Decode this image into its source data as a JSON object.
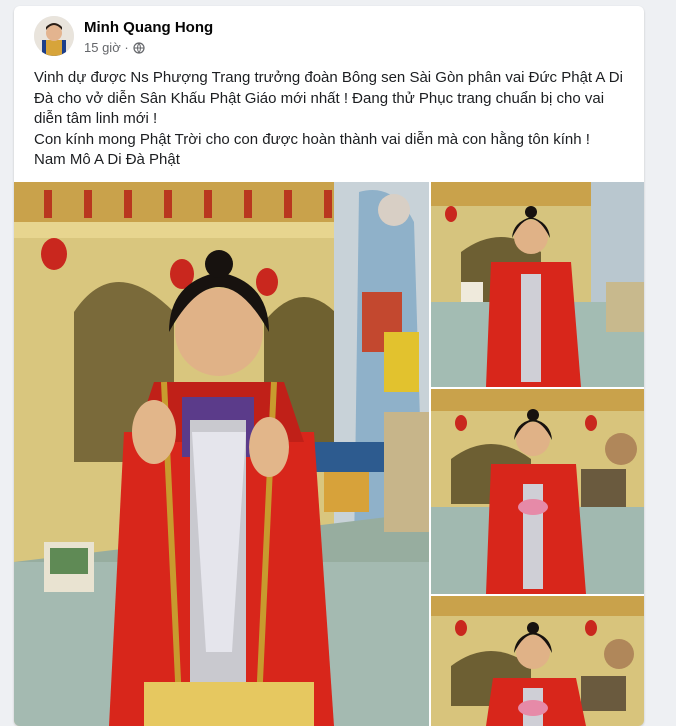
{
  "post": {
    "author": "Minh Quang Hong",
    "time": "15 giờ ·",
    "privacy_icon": "globe-icon",
    "text_lines": [
      "Vinh dự được Ns Phượng Trang trưởng đoàn Bông sen Sài Gòn phân vai Đức Phật A Di Đà cho vở diễn Sân Khấu Phật Giáo mới nhất ! Đang thử Phục trang chuẩn bị cho vai diễn tâm linh mới !",
      "Con kính mong Phật Trời cho con được hoàn thành vai diễn mà con hằng tôn kính !",
      "Nam Mô A Di Đà Phật"
    ]
  },
  "colors": {
    "robe": "#d8261b",
    "gold": "#c89b2e",
    "wall": "#d7c37a",
    "floor": "#9fb6ad",
    "lantern": "#c9271e"
  }
}
